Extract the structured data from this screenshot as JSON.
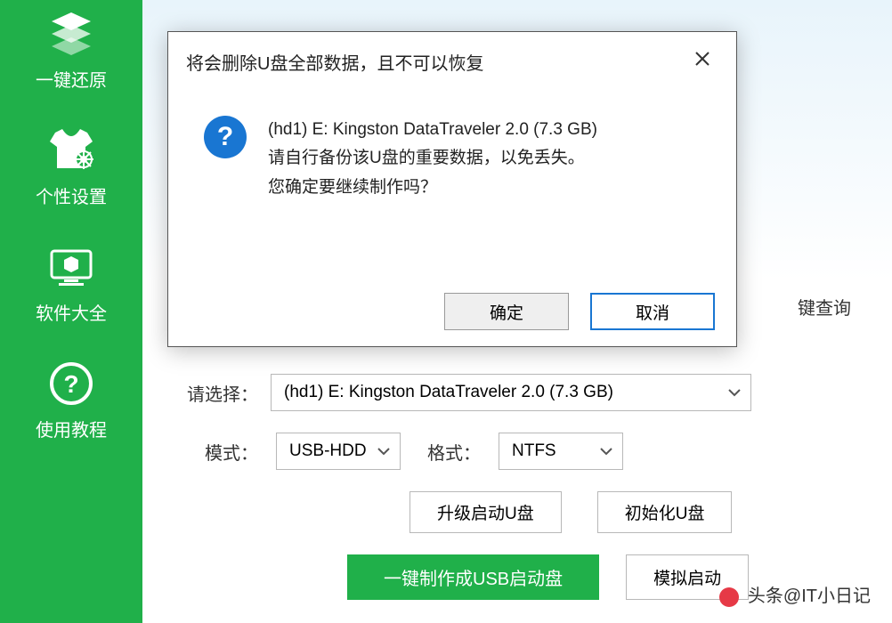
{
  "sidebar": {
    "items": [
      {
        "label": "一键还原",
        "icon": "restore-stack-icon"
      },
      {
        "label": "个性设置",
        "icon": "tshirt-gear-icon"
      },
      {
        "label": "软件大全",
        "icon": "monitor-cube-icon"
      },
      {
        "label": "使用教程",
        "icon": "help-circle-icon"
      }
    ]
  },
  "modal": {
    "title": "将会删除U盘全部数据，且不可以恢复",
    "line1": "(hd1) E: Kingston DataTraveler 2.0 (7.3 GB)",
    "line2": "请自行备份该U盘的重要数据，以免丢失。",
    "line3": "您确定要继续制作吗？",
    "ok": "确定",
    "cancel": "取消"
  },
  "main": {
    "key_query_label": "键查询",
    "select_label": "请选择：",
    "select_value": "(hd1) E: Kingston DataTraveler 2.0 (7.3 GB)",
    "mode_label": "模式：",
    "mode_value": "USB-HDD",
    "format_label": "格式：",
    "format_value": "NTFS",
    "upgrade_btn": "升级启动U盘",
    "init_btn": "初始化U盘",
    "make_btn": "一键制作成USB启动盘",
    "simulate_btn": "模拟启动"
  },
  "watermark": "头条@IT小日记"
}
